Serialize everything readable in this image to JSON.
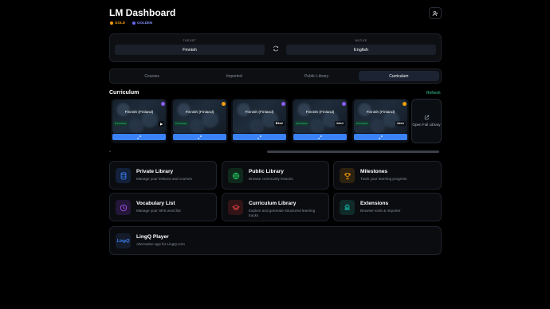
{
  "header": {
    "title": "LM Dashboard",
    "badges": [
      {
        "label": "GOLD",
        "color": "#f59e0b"
      },
      {
        "label": "GOLDEN",
        "color": "#6366f1"
      }
    ],
    "user_icon": "user-icon"
  },
  "languages": {
    "target_label": "TARGET",
    "target_value": "Finnish",
    "native_label": "NATIVE",
    "native_value": "English",
    "swap_icon": "swap-icon"
  },
  "tabs": [
    {
      "label": "Courses",
      "active": false
    },
    {
      "label": "Imported",
      "active": false
    },
    {
      "label": "Public Library",
      "active": false
    },
    {
      "label": "Curriculum",
      "active": true
    }
  ],
  "curriculum": {
    "title": "Curriculum",
    "refresh_label": "Refresh",
    "cards": [
      {
        "title": "Finnish (Finland)",
        "tag": "Purchased",
        "stat": "▶",
        "icon_color": "#8b5cf6"
      },
      {
        "title": "Finnish (Finland)",
        "tag": "Purchased",
        "stat": "",
        "icon_color": "#f59e0b"
      },
      {
        "title": "Finnish (Finland)",
        "tag": "",
        "stat": "B1b2",
        "icon_color": "#8b5cf6"
      },
      {
        "title": "Finnish (Finland)",
        "tag": "Purchased",
        "stat": "b2c1",
        "icon_color": "#8b5cf6"
      },
      {
        "title": "Finnish (Finland)",
        "tag": "Purchased",
        "stat": "b2c1",
        "icon_color": "#f59e0b"
      }
    ],
    "open_library_label": "Open Full Library"
  },
  "tiles": [
    {
      "name": "Private Library",
      "desc": "Manage your lessons and courses",
      "icon": "database-icon",
      "color": "#3b82f6",
      "bg": "#13203a"
    },
    {
      "name": "Public Library",
      "desc": "Browse community lessons",
      "icon": "globe-icon",
      "color": "#22c55e",
      "bg": "#0f2a1c"
    },
    {
      "name": "Milestones",
      "desc": "Track your learning progress",
      "icon": "trophy-icon",
      "color": "#f59e0b",
      "bg": "#2e2210"
    },
    {
      "name": "Vocabulary List",
      "desc": "Manage your SRS word list",
      "icon": "clock-icon",
      "color": "#a855f7",
      "bg": "#241638"
    },
    {
      "name": "Curriculum Library",
      "desc": "Explore and generate structured learning tracks",
      "icon": "graduation-cap-icon",
      "color": "#ef4444",
      "bg": "#321417"
    },
    {
      "name": "Extensions",
      "desc": "Browser tools & Importer",
      "icon": "puzzle-icon",
      "color": "#14b8a6",
      "bg": "#0f2a28"
    },
    {
      "name": "LingQ Player",
      "desc": "Alternative app for LingQ.com",
      "icon": "lingq-logo-icon",
      "color": "#3b82f6",
      "bg": "#141c2c",
      "logo_text": "LingQ"
    }
  ]
}
